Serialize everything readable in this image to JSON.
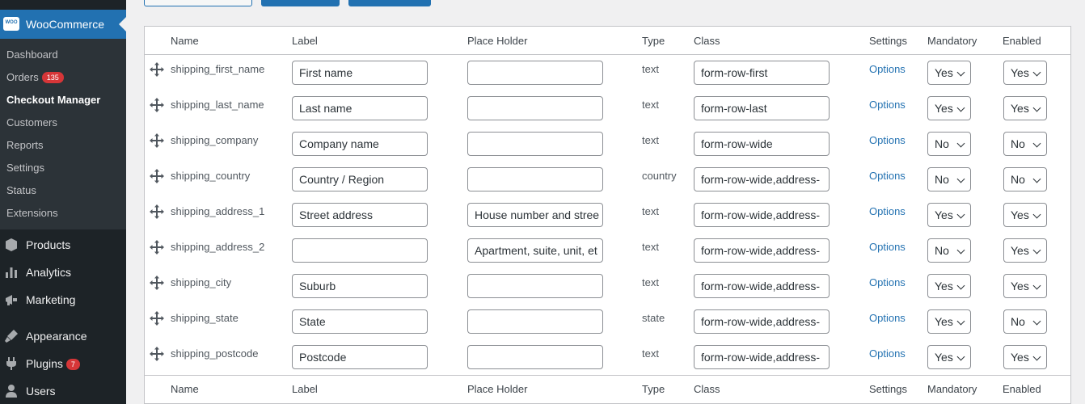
{
  "sidebar": {
    "active_menu": "WooCommerce",
    "logo_text": "WOO",
    "submenu": [
      {
        "label": "Dashboard"
      },
      {
        "label": "Orders",
        "badge": "135"
      },
      {
        "label": "Checkout Manager",
        "current": true
      },
      {
        "label": "Customers"
      },
      {
        "label": "Reports"
      },
      {
        "label": "Settings"
      },
      {
        "label": "Status"
      },
      {
        "label": "Extensions"
      }
    ],
    "menu": [
      {
        "label": "Products",
        "icon": "products-icon"
      },
      {
        "label": "Analytics",
        "icon": "analytics-icon"
      },
      {
        "label": "Marketing",
        "icon": "marketing-icon"
      },
      {
        "label": "Appearance",
        "icon": "appearance-icon"
      },
      {
        "label": "Plugins",
        "icon": "plugins-icon",
        "badge": "7"
      },
      {
        "label": "Users",
        "icon": "users-icon"
      }
    ]
  },
  "table": {
    "columns": [
      "Name",
      "Label",
      "Place Holder",
      "Type",
      "Class",
      "Settings",
      "Mandatory",
      "Enabled"
    ],
    "options_label": "Options",
    "rows": [
      {
        "name": "shipping_first_name",
        "label": "First name",
        "placeholder": "",
        "type": "text",
        "class": "form-row-first",
        "mandatory": "Yes",
        "enabled": "Yes"
      },
      {
        "name": "shipping_last_name",
        "label": "Last name",
        "placeholder": "",
        "type": "text",
        "class": "form-row-last",
        "mandatory": "Yes",
        "enabled": "Yes"
      },
      {
        "name": "shipping_company",
        "label": "Company name",
        "placeholder": "",
        "type": "text",
        "class": "form-row-wide",
        "mandatory": "No",
        "enabled": "No"
      },
      {
        "name": "shipping_country",
        "label": "Country / Region",
        "placeholder": "",
        "type": "country",
        "class": "form-row-wide,address-",
        "mandatory": "No",
        "enabled": "No"
      },
      {
        "name": "shipping_address_1",
        "label": "Street address",
        "placeholder": "House number and stree",
        "type": "text",
        "class": "form-row-wide,address-",
        "mandatory": "Yes",
        "enabled": "Yes"
      },
      {
        "name": "shipping_address_2",
        "label": "",
        "placeholder": "Apartment, suite, unit, et",
        "type": "text",
        "class": "form-row-wide,address-",
        "mandatory": "No",
        "enabled": "Yes"
      },
      {
        "name": "shipping_city",
        "label": "Suburb",
        "placeholder": "",
        "type": "text",
        "class": "form-row-wide,address-",
        "mandatory": "Yes",
        "enabled": "Yes"
      },
      {
        "name": "shipping_state",
        "label": "State",
        "placeholder": "",
        "type": "state",
        "class": "form-row-wide,address-",
        "mandatory": "Yes",
        "enabled": "No"
      },
      {
        "name": "shipping_postcode",
        "label": "Postcode",
        "placeholder": "",
        "type": "text",
        "class": "form-row-wide,address-",
        "mandatory": "Yes",
        "enabled": "Yes"
      }
    ]
  },
  "colors": {
    "sidebar_bg": "#1d2327",
    "submenu_bg": "#2c3338",
    "accent": "#2271b1",
    "badge": "#d63638"
  }
}
